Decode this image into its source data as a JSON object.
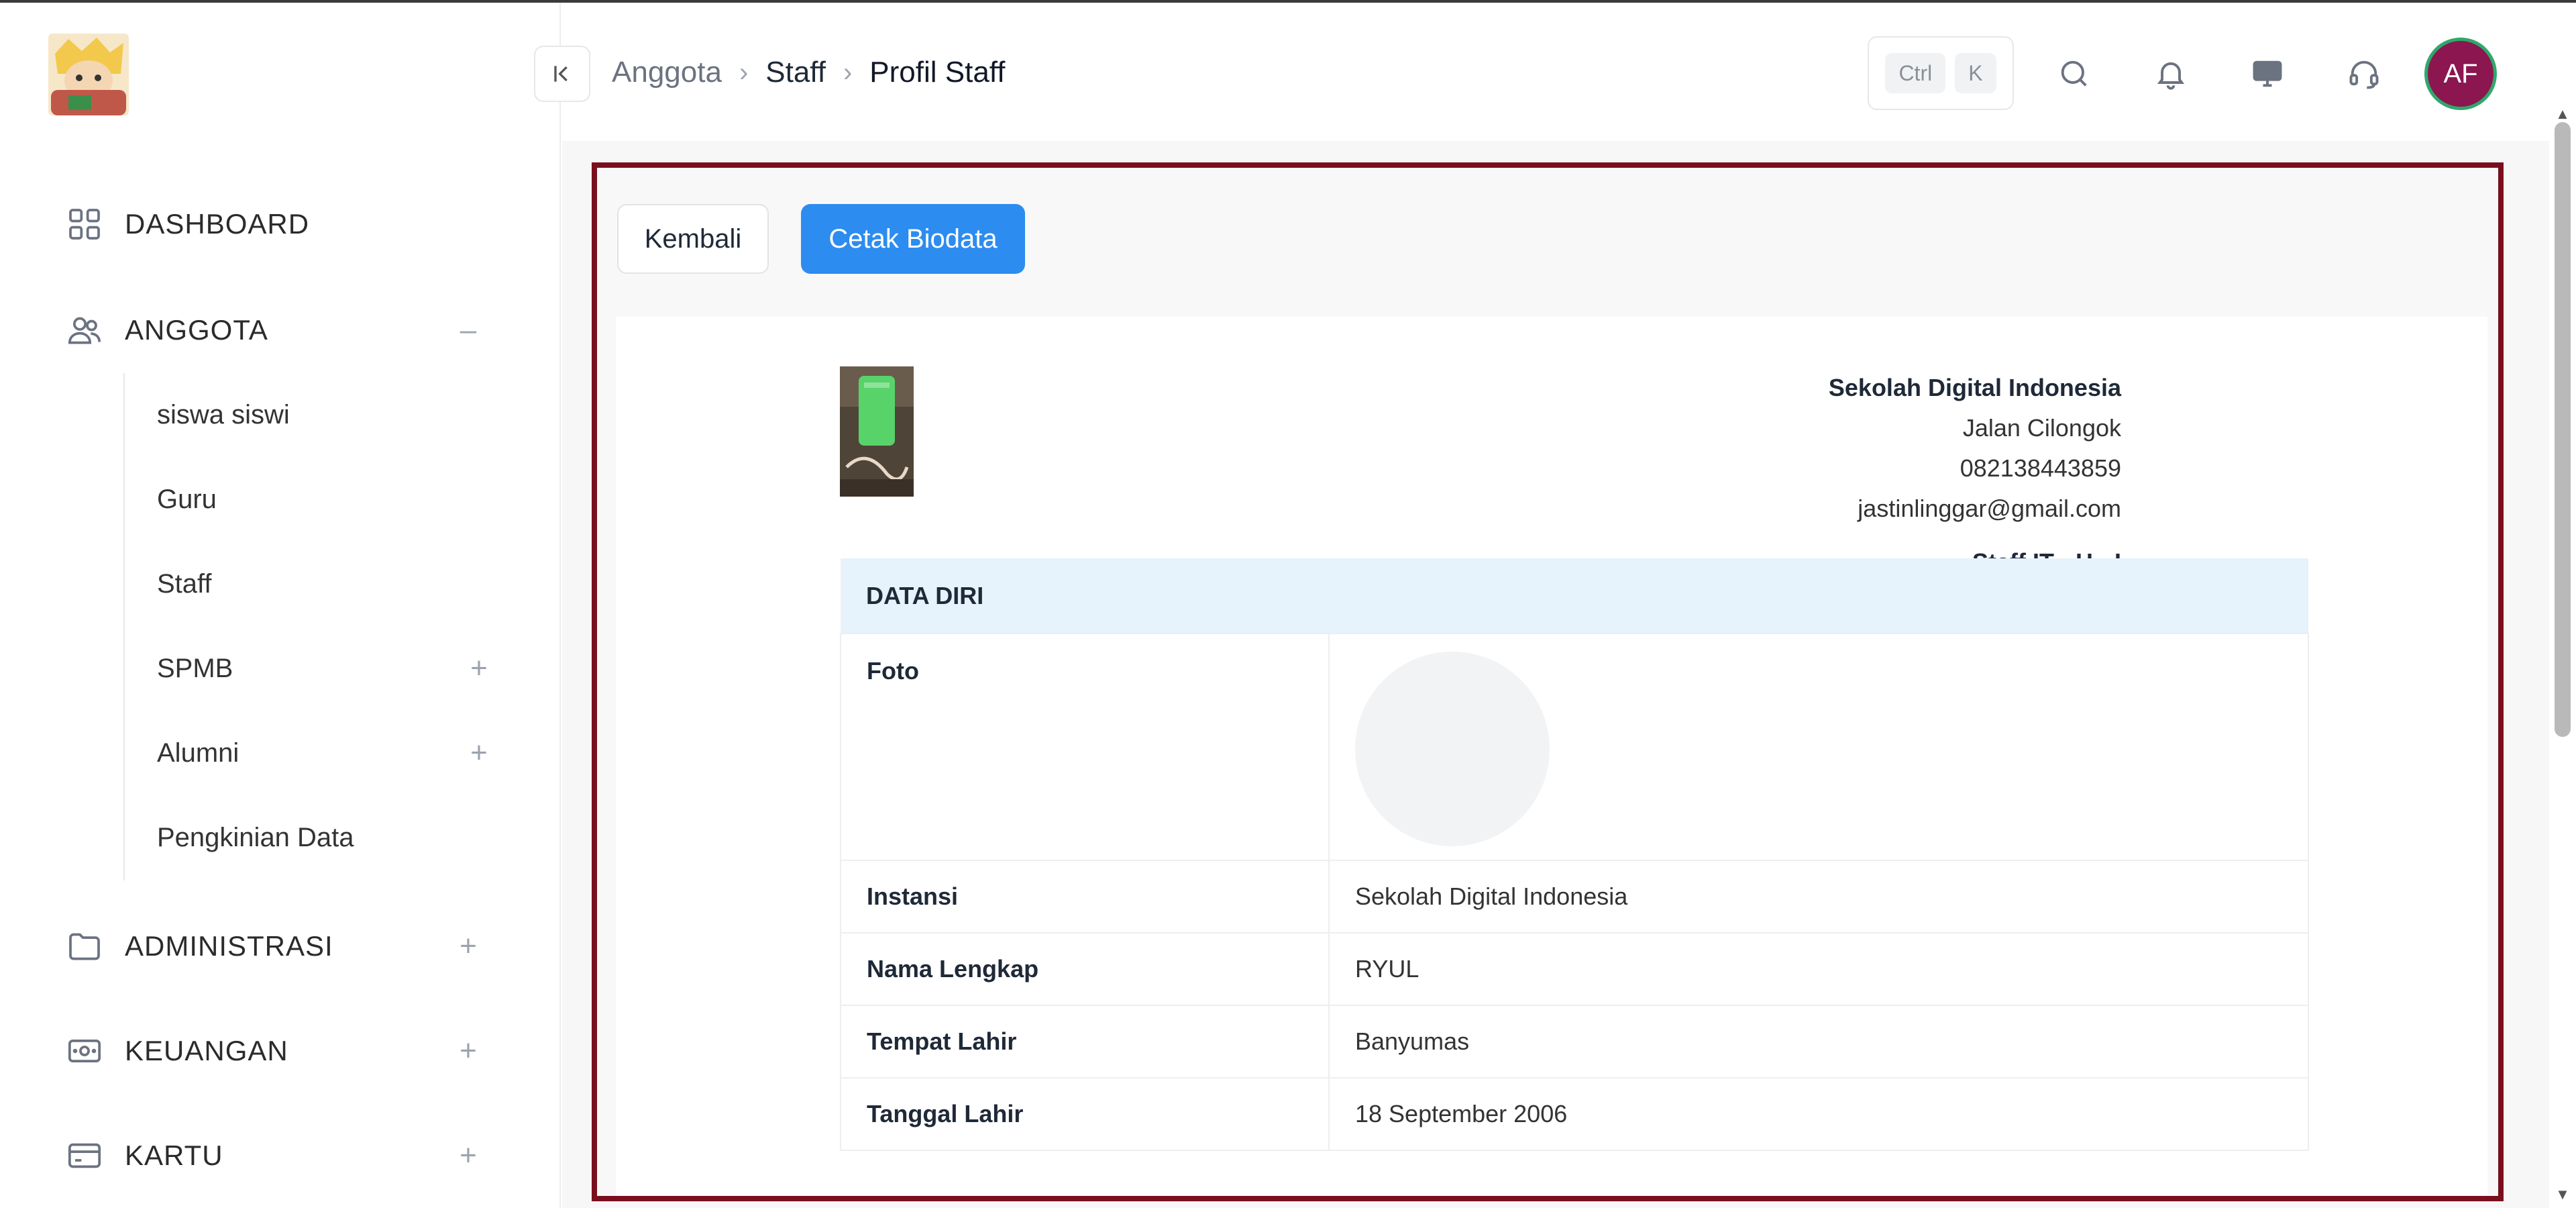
{
  "sidebar": {
    "items": [
      {
        "label": "DASHBOARD",
        "icon": "grid-icon"
      },
      {
        "label": "ANGGOTA",
        "icon": "users-icon",
        "toggle": "–"
      },
      {
        "label": "ADMINISTRASI",
        "icon": "folder-icon",
        "toggle": "+"
      },
      {
        "label": "KEUANGAN",
        "icon": "cash-icon",
        "toggle": "+"
      },
      {
        "label": "KARTU",
        "icon": "card-icon",
        "toggle": "+"
      }
    ],
    "anggota_sub": [
      {
        "label": "siswa siswi"
      },
      {
        "label": "Guru"
      },
      {
        "label": "Staff"
      },
      {
        "label": "SPMB",
        "toggle": "+"
      },
      {
        "label": "Alumni",
        "toggle": "+"
      },
      {
        "label": "Pengkinian Data"
      }
    ]
  },
  "header": {
    "breadcrumb": [
      "Anggota",
      "Staff",
      "Profil Staff"
    ],
    "shortcut": [
      "Ctrl",
      "K"
    ],
    "avatar_initials": "AF",
    "avatar_color": "#8b1650"
  },
  "actions": {
    "back": "Kembali",
    "print": "Cetak Biodata",
    "print_color": "#2d8cf0"
  },
  "org": {
    "name": "Sekolah Digital Indonesia",
    "address": "Jalan Cilongok",
    "phone": "082138443859",
    "email": "jastinlinggar@gmail.com",
    "role": "Staff IT - H - I"
  },
  "table": {
    "section": "DATA DIRI",
    "rows": [
      {
        "label": "Foto",
        "value": ""
      },
      {
        "label": "Instansi",
        "value": "Sekolah Digital Indonesia"
      },
      {
        "label": "Nama Lengkap",
        "value": "RYUL"
      },
      {
        "label": "Tempat Lahir",
        "value": "Banyumas"
      },
      {
        "label": "Tanggal Lahir",
        "value": "18 September 2006"
      }
    ]
  }
}
